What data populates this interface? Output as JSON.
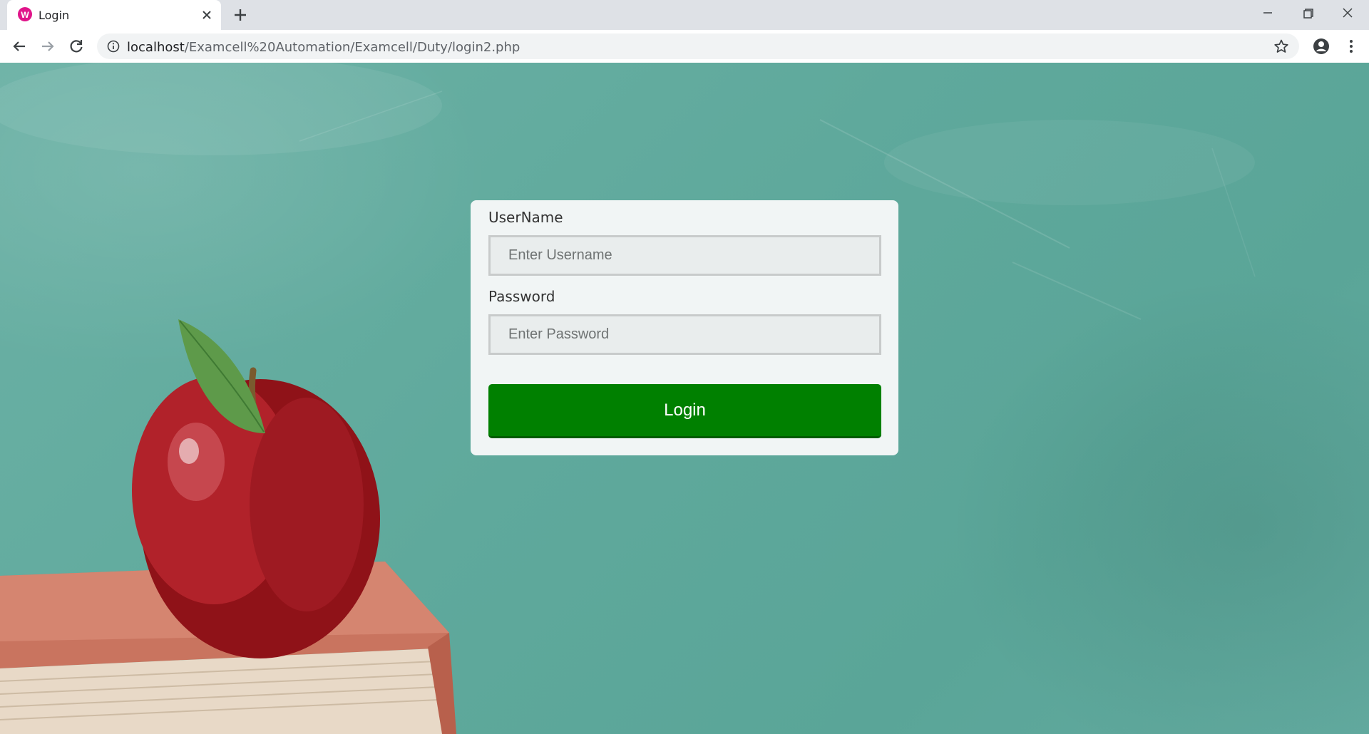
{
  "browser": {
    "tab": {
      "title": "Login"
    },
    "address_bar": {
      "host": "localhost",
      "path": "/Examcell%20Automation/Examcell/Duty/login2.php"
    }
  },
  "login_form": {
    "username_label": "UserName",
    "username_placeholder": "Enter Username",
    "username_value": "",
    "password_label": "Password",
    "password_placeholder": "Enter Password",
    "password_value": "",
    "login_button": "Login"
  },
  "colors": {
    "chalkboard": "#5fa99c",
    "card": "#f1f5f5",
    "login_button": "#008000",
    "tab_favicon": "#e0158a"
  },
  "icons": [
    "back-icon",
    "forward-icon",
    "reload-icon",
    "info-icon",
    "star-icon",
    "account-icon",
    "menu-icon",
    "close-icon",
    "plus-icon",
    "minimize-icon",
    "restore-icon"
  ]
}
